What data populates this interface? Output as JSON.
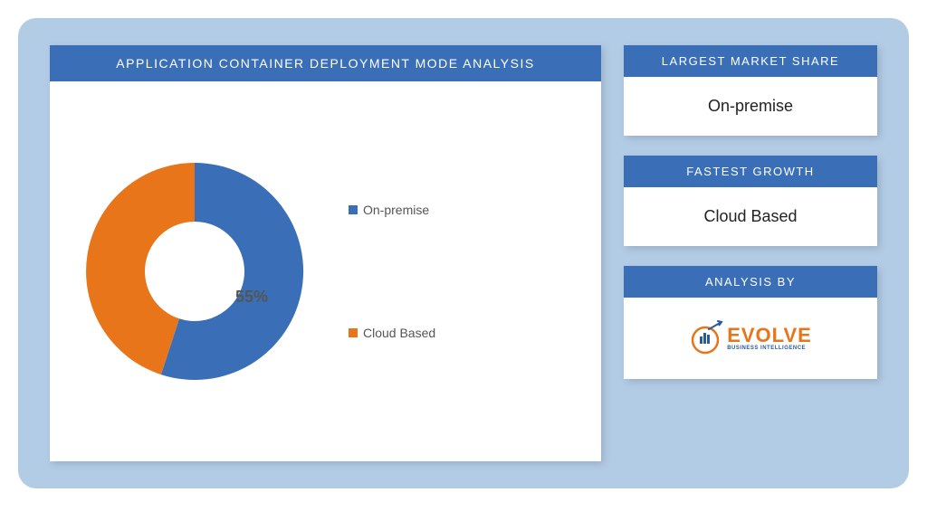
{
  "chart_data": {
    "type": "pie",
    "title": "APPLICATION CONTAINER DEPLOYMENT MODE ANALYSIS",
    "categories": [
      "On-premise",
      "Cloud Based"
    ],
    "values": [
      55,
      45
    ],
    "colors": [
      "#3a6fb7",
      "#e8751a"
    ],
    "data_labels": {
      "On-premise": "55%"
    }
  },
  "chart_title": "APPLICATION CONTAINER DEPLOYMENT MODE ANALYSIS",
  "legend": [
    {
      "name": "On-premise",
      "color": "#3a6fb7"
    },
    {
      "name": "Cloud Based",
      "color": "#e8751a"
    }
  ],
  "slice_label": "55%",
  "cards": {
    "largest_share": {
      "header": "LARGEST MARKET SHARE",
      "value": "On-premise"
    },
    "fastest_growth": {
      "header": "FASTEST GROWTH",
      "value": "Cloud Based"
    },
    "analysis_by": {
      "header": "ANALYSIS BY"
    }
  },
  "logo": {
    "brand": "EVOLVE",
    "tagline": "BUSINESS INTELLIGENCE"
  }
}
